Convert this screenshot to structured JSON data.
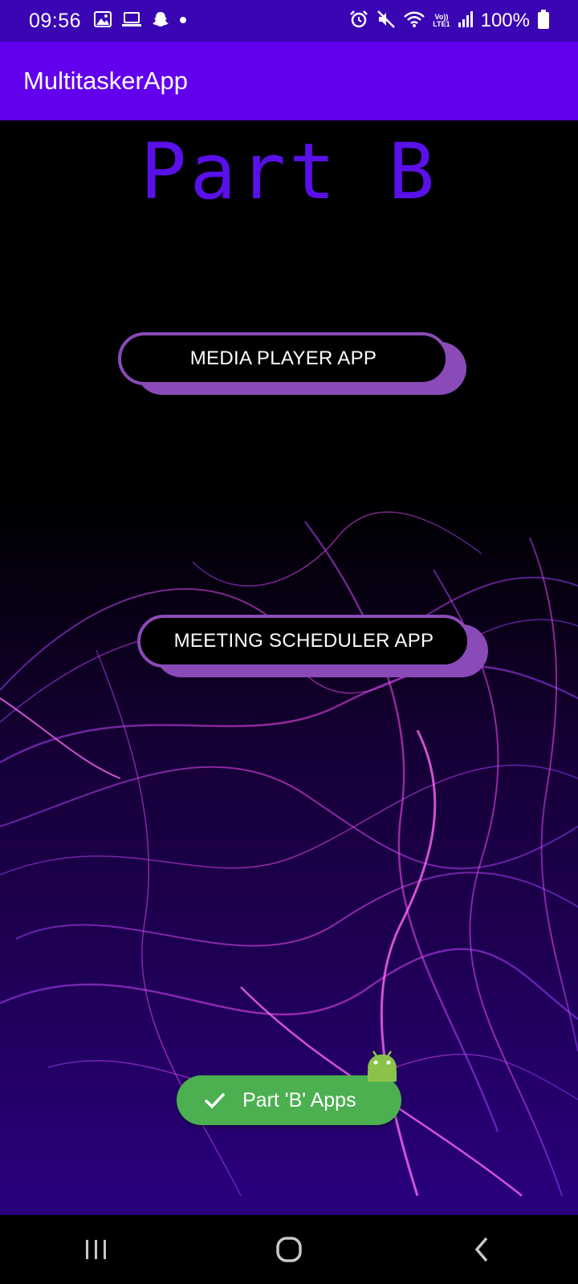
{
  "status_bar": {
    "time": "09:56",
    "battery_percent": "100%",
    "network_label": "LTE1",
    "volte_label": "Vo))",
    "left_icons": [
      "image-icon",
      "laptop-icon",
      "snapchat-icon",
      "dot-icon"
    ],
    "right_icons": [
      "alarm-icon",
      "mute-icon",
      "wifi-icon",
      "signal-icon",
      "battery-icon"
    ]
  },
  "app_bar": {
    "title": "MultitaskerApp"
  },
  "main": {
    "heading": "Part B",
    "buttons": [
      {
        "label": "MEDIA PLAYER APP"
      },
      {
        "label": "MEETING SCHEDULER APP"
      }
    ]
  },
  "toast": {
    "text": "Part 'B' Apps",
    "icon": "check-icon",
    "badge_icon": "android-icon"
  },
  "nav_bar": {
    "icons": [
      "recents-icon",
      "home-icon",
      "back-icon"
    ]
  },
  "colors": {
    "status_bar": "#3a06b4",
    "app_bar": "#6200ee",
    "heading": "#5a10e8",
    "button_border": "#8a4ab8",
    "toast": "#4caf50",
    "background": "#000000"
  }
}
